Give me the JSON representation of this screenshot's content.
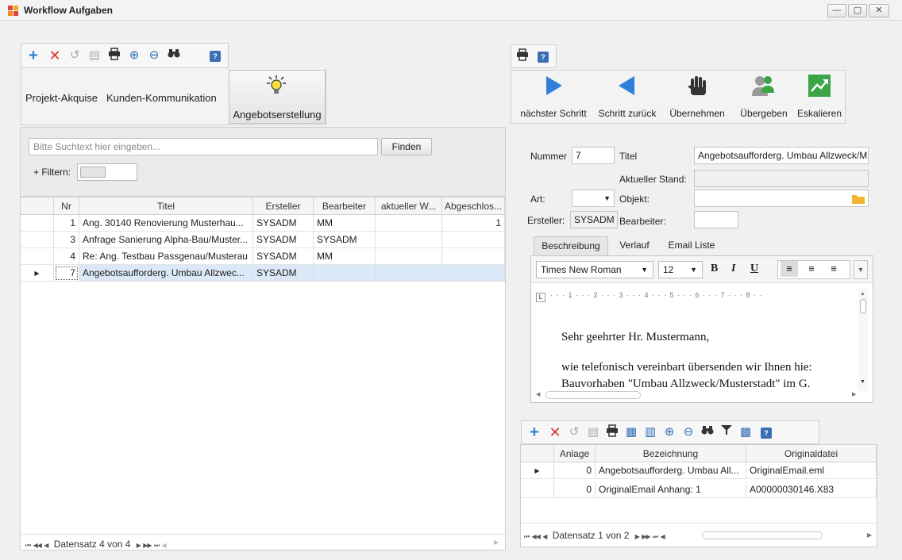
{
  "window": {
    "title": "Workflow Aufgaben",
    "controls": [
      "minimize",
      "maximize",
      "close"
    ]
  },
  "left_toolbar": {
    "icons": [
      "add-icon",
      "delete-icon",
      "undo-icon",
      "save-icon",
      "print-icon",
      "zoom-in-icon",
      "zoom-out-icon",
      "binoculars-icon",
      "help-icon"
    ]
  },
  "categories": {
    "items": [
      "Projekt-Akquise",
      "Kunden-Kommunikation",
      "Angebotserstellung"
    ],
    "active": "Angebotserstellung",
    "active_icon": "lightbulb-icon"
  },
  "search": {
    "placeholder": "Bitte Suchtext hier eingeben...",
    "button_label": "Finden",
    "filter_label": "+ Filtern:"
  },
  "task_grid": {
    "columns": [
      "Nr",
      "Titel",
      "Ersteller",
      "Bearbeiter",
      "aktueller W...",
      "Abgeschlos..."
    ],
    "rows": [
      {
        "nr": "1",
        "titel": "Ang. 30140  Renovierung Musterhau...",
        "ersteller": "SYSADM",
        "bearbeiter": "MM",
        "aktueller": "",
        "abgeschlossen": "1"
      },
      {
        "nr": "3",
        "titel": "Anfrage Sanierung Alpha-Bau/Muster...",
        "ersteller": "SYSADM",
        "bearbeiter": "SYSADM",
        "aktueller": "",
        "abgeschlossen": ""
      },
      {
        "nr": "4",
        "titel": "Re: Ang. Testbau Passgenau/Musterau",
        "ersteller": "SYSADM",
        "bearbeiter": "MM",
        "aktueller": "",
        "abgeschlossen": ""
      },
      {
        "nr": "7",
        "titel": "Angebotsaufforderg. Umbau Allzwec...",
        "ersteller": "SYSADM",
        "bearbeiter": "",
        "aktueller": "",
        "abgeschlossen": ""
      }
    ],
    "selected_row_index": 3,
    "pager": "Datensatz 4 von 4"
  },
  "right_toolbar": {
    "icons": [
      "print-icon",
      "help-icon"
    ]
  },
  "workflow_actions": [
    {
      "label": "nächster Schritt",
      "icon": "play-right-icon"
    },
    {
      "label": "Schritt zurück",
      "icon": "play-left-icon"
    },
    {
      "label": "Übernehmen",
      "icon": "hand-icon"
    },
    {
      "label": "Übergeben",
      "icon": "users-icon"
    },
    {
      "label": "Eskalieren",
      "icon": "trend-up-icon"
    }
  ],
  "detail": {
    "nummer_label": "Nummer",
    "nummer_value": "7",
    "titel_label": "Titel",
    "titel_value": "Angebotsaufforderg. Umbau Allzweck/M",
    "stand_label": "Aktueller Stand:",
    "stand_value": "",
    "art_label": "Art:",
    "art_value": "",
    "objekt_label": "Objekt:",
    "objekt_value": "",
    "ersteller_label": "Ersteller:",
    "ersteller_value": "SYSADM",
    "bearbeiter_label": "Bearbeiter:",
    "bearbeiter_value": ""
  },
  "detail_tabs": {
    "items": [
      "Beschreibung",
      "Verlauf",
      "Email Liste"
    ],
    "active": "Beschreibung"
  },
  "editor": {
    "font": "Times New Roman",
    "size": "12",
    "ruler": "· · · 1 · · · 2 · · · 3 · · · 4 · · · 5 · · · 6 · · · 7 · · · 8 · ·",
    "lines": [
      "Sehr geehrter Hr. Mustermann,",
      "wie telefonisch vereinbart übersenden wir Ihnen hie:",
      "Bauvorhaben \"Umbau Allzweck/Musterstadt\" im G."
    ]
  },
  "attachments_toolbar": {
    "icons": [
      "add-icon",
      "delete-icon",
      "undo-icon",
      "save-icon",
      "print-icon",
      "preview-icon",
      "columns-icon",
      "zoom-in-icon",
      "zoom-out-icon",
      "binoculars-icon",
      "filter-icon",
      "grid-settings-icon",
      "help-icon"
    ]
  },
  "attachments_grid": {
    "columns": [
      "Anlage",
      "Bezeichnung",
      "Originaldatei"
    ],
    "rows": [
      {
        "anlage": "0",
        "bezeichnung": "Angebotsaufforderg. Umbau All...",
        "originaldatei": "OriginalEmail.eml"
      },
      {
        "anlage": "0",
        "bezeichnung": "OriginalEmail Anhang: 1",
        "originaldatei": "A00000030146.X83"
      }
    ],
    "pager": "Datensatz 1 von 2"
  },
  "colors": {
    "accent_blue": "#2f80d8",
    "delete_red": "#d9342b",
    "add_blue": "#2f80d8",
    "escalate_green": "#3aa447",
    "selection": "#dbe8f8"
  }
}
